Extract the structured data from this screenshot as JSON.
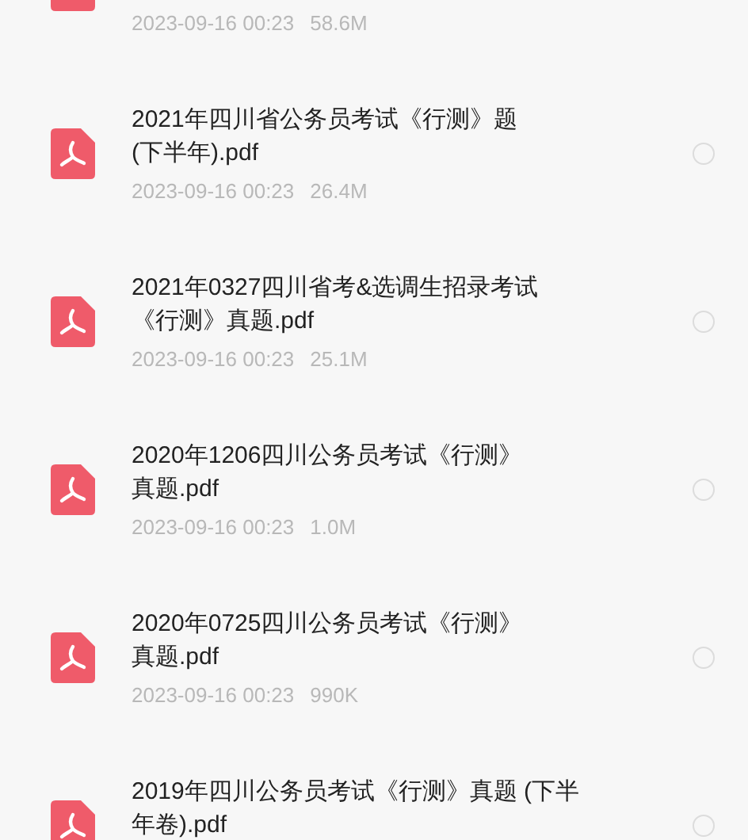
{
  "files": [
    {
      "kind": "pdf",
      "date": "2023-09-16 00:23",
      "size": "58.6M"
    },
    {
      "kind": "pdf",
      "title": [
        "2021年四川省公务员考试《行测》题",
        "(下半年).pdf"
      ],
      "date": "2023-09-16 00:23",
      "size": "26.4M",
      "selected": false
    },
    {
      "kind": "pdf",
      "title": [
        "2021年0327四川省考&选调生招录考试",
        "《行测》真题.pdf"
      ],
      "date": "2023-09-16 00:23",
      "size": "25.1M",
      "selected": false
    },
    {
      "kind": "pdf",
      "title": [
        "2020年1206四川公务员考试《行测》",
        "真题.pdf"
      ],
      "date": "2023-09-16 00:23",
      "size": "1.0M",
      "selected": false
    },
    {
      "kind": "pdf",
      "title": [
        "2020年0725四川公务员考试《行测》",
        "真题.pdf"
      ],
      "date": "2023-09-16 00:23",
      "size": "990K",
      "selected": false
    },
    {
      "kind": "pdf",
      "title": [
        "2019年四川公务员考试《行测》真题 (下半",
        "年卷).pdf"
      ],
      "selected": false
    }
  ]
}
